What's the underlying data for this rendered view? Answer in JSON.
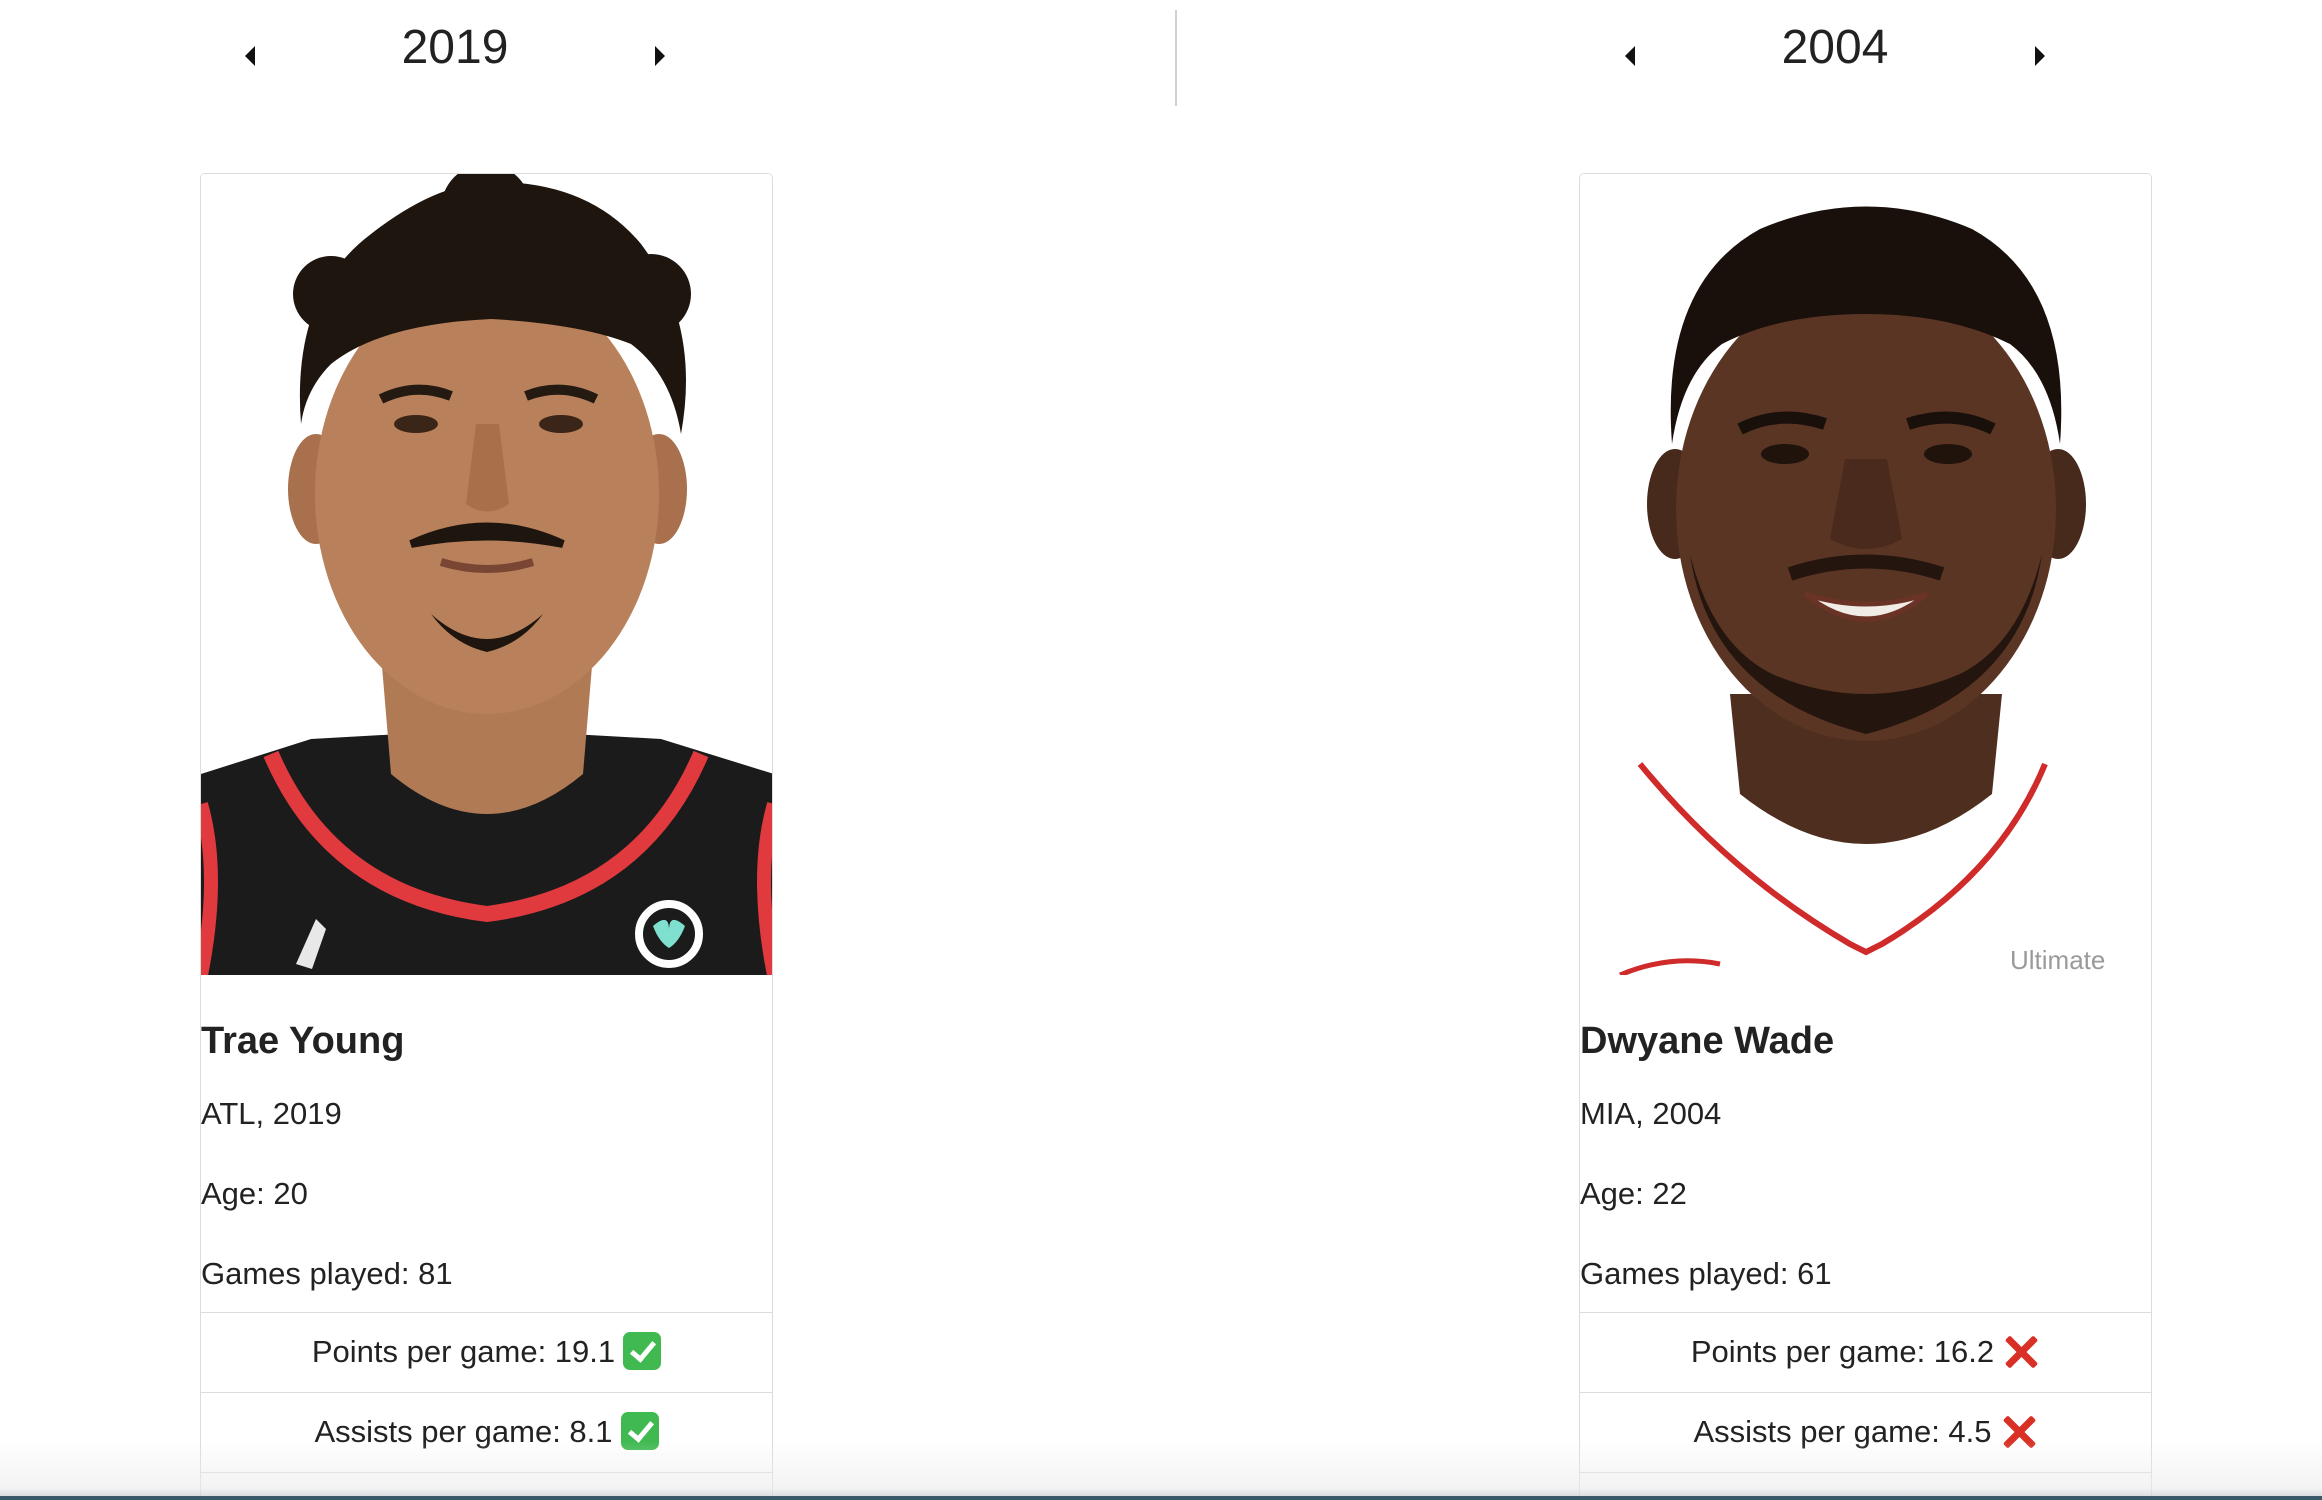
{
  "left_panel": {
    "year": "2019",
    "player": {
      "name": "Trae Young",
      "team_year": "ATL, 2019",
      "age": "Age: 20",
      "games_played": "Games played: 81",
      "stats": [
        {
          "label": "Points per game: 19.1",
          "result": "check"
        },
        {
          "label": "Assists per game: 8.1",
          "result": "check"
        }
      ],
      "jersey_color": "#1b1b1b",
      "trim_color": "#e03a3e"
    }
  },
  "right_panel": {
    "year": "2004",
    "player": {
      "name": "Dwyane Wade",
      "team_year": "MIA, 2004",
      "age": "Age: 22",
      "games_played": "Games played: 61",
      "stats": [
        {
          "label": "Points per game: 16.2",
          "result": "cross"
        },
        {
          "label": "Assists per game: 4.5",
          "result": "cross"
        }
      ],
      "jersey_color": "#ffffff",
      "trim_color": "#d02b2b",
      "jersey_text": "Ultimate"
    }
  },
  "icons": {
    "prev": "caret-left-icon",
    "next": "caret-right-icon",
    "check": "check-mark-icon",
    "cross": "cross-mark-icon"
  },
  "colors": {
    "check_green": "#3fb950",
    "cross_red": "#d93025",
    "border": "#dcdcdc"
  }
}
